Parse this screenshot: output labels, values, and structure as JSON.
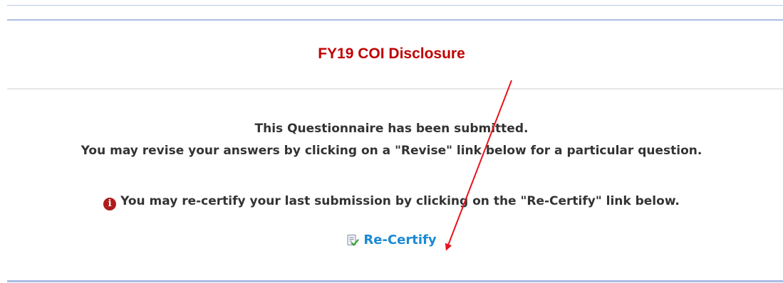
{
  "header": {
    "title": "FY19 COI Disclosure"
  },
  "status": {
    "line1": "This Questionnaire has been submitted.",
    "line2": "You may revise your answers by clicking on a \"Revise\" link below for a particular question."
  },
  "notice": {
    "icon": "info-circle-icon",
    "text": "You may re-certify your last submission by clicking on the \"Re-Certify\" link below."
  },
  "actions": {
    "recertify_label": "Re-Certify",
    "recertify_icon": "recertify-checklist-icon"
  },
  "colors": {
    "title": "#c00000",
    "link": "#1a8ad4",
    "notice_icon": "#b01c1c",
    "annotation_arrow": "#e8141c",
    "rule_blue": "#a9bde3"
  }
}
